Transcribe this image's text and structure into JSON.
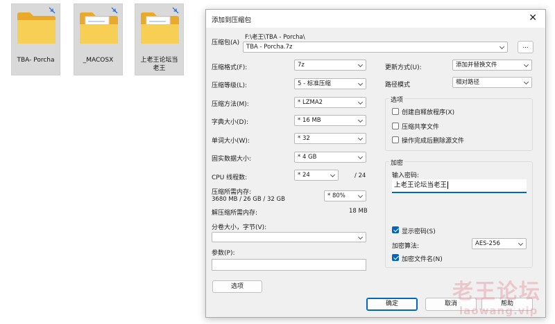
{
  "desktop": {
    "folders": [
      {
        "label": "TBA- Porcha"
      },
      {
        "label": "_MACOSX"
      },
      {
        "label": "上老王论坛当老王"
      }
    ]
  },
  "dialog": {
    "title": "添加到压缩包",
    "close_glyph": "✕",
    "archive": {
      "label": "压缩包(A)",
      "path": "F:\\老王\\TBA - Porcha\\",
      "name_value": "TBA - Porcha.7z",
      "browse_label": "..."
    },
    "left": {
      "format_label": "压缩格式(F):",
      "format_value": "7z",
      "level_label": "压缩等级(L):",
      "level_value": "5 - 标准压缩",
      "method_label": "压缩方法(M):",
      "method_value": "* LZMA2",
      "dict_label": "字典大小(D):",
      "dict_value": "* 16 MB",
      "word_label": "单词大小(W):",
      "word_value": "* 32",
      "solid_label": "固实数据大小:",
      "solid_value": "* 4 GB",
      "threads_label": "CPU 线程数:",
      "threads_value": "* 24",
      "threads_total": "/ 24",
      "mem_label": "压缩所需内存:",
      "mem_detail": "3680 MB / 26 GB / 32 GB",
      "mem_percent": "* 80%",
      "decomp_label": "解压缩所需内存:",
      "decomp_value": "18 MB",
      "split_label": "分卷大小，字节(V):",
      "split_value": "",
      "params_label": "参数(P):",
      "params_value": "",
      "options_button": "选项"
    },
    "right": {
      "update_label": "更新方式(U):",
      "update_value": "添加并替换文件",
      "pathmode_label": "路径模式",
      "pathmode_value": "相对路径",
      "options_group": {
        "title": "选项",
        "items": [
          {
            "label": "创建自释放程序(X)",
            "checked": false
          },
          {
            "label": "压缩共享文件",
            "checked": false
          },
          {
            "label": "操作完成后删除源文件",
            "checked": false
          }
        ]
      },
      "encryption_group": {
        "title": "加密",
        "password_label": "输入密码:",
        "password_value": "上老王论坛当老王",
        "show_password_label": "显示密码(S)",
        "show_password_checked": true,
        "method_label": "加密算法:",
        "method_value": "AES-256",
        "encrypt_names_label": "加密文件名(N)",
        "encrypt_names_checked": true
      }
    },
    "buttons": {
      "ok": "确定",
      "cancel": "取消",
      "help": "帮助"
    }
  },
  "watermark": {
    "text": "老王论坛",
    "url": "laowang.vip"
  },
  "colors": {
    "accent": "#0067c0",
    "folder": "#f6c543",
    "watermark": "#e2788c"
  }
}
